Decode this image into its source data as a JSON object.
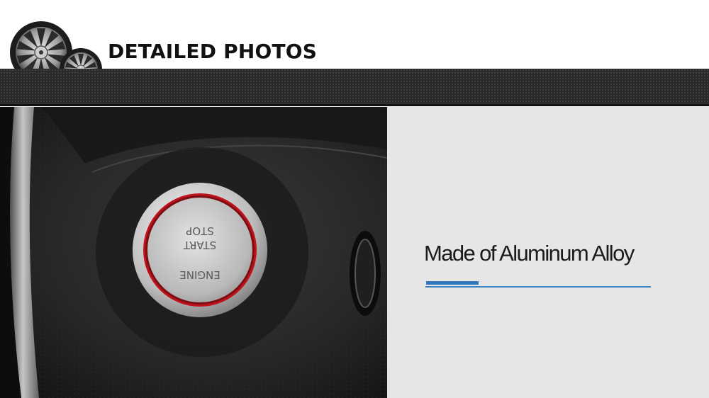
{
  "header": {
    "title": "DETAILED PHOTOS",
    "logo_icon": "alloy-wheels-icon"
  },
  "photo": {
    "subject": "engine-start-stop-button",
    "button_text_line1": "START",
    "button_text_line2": "STOP",
    "button_text_line3": "ENGINE"
  },
  "feature": {
    "caption": "Made of Aluminum Alloy"
  },
  "colors": {
    "accent_blue": "#2f78c0",
    "panel_gray": "#e6e6e6",
    "band_dark": "#2a2a2a",
    "ring_red": "#c0121b"
  }
}
